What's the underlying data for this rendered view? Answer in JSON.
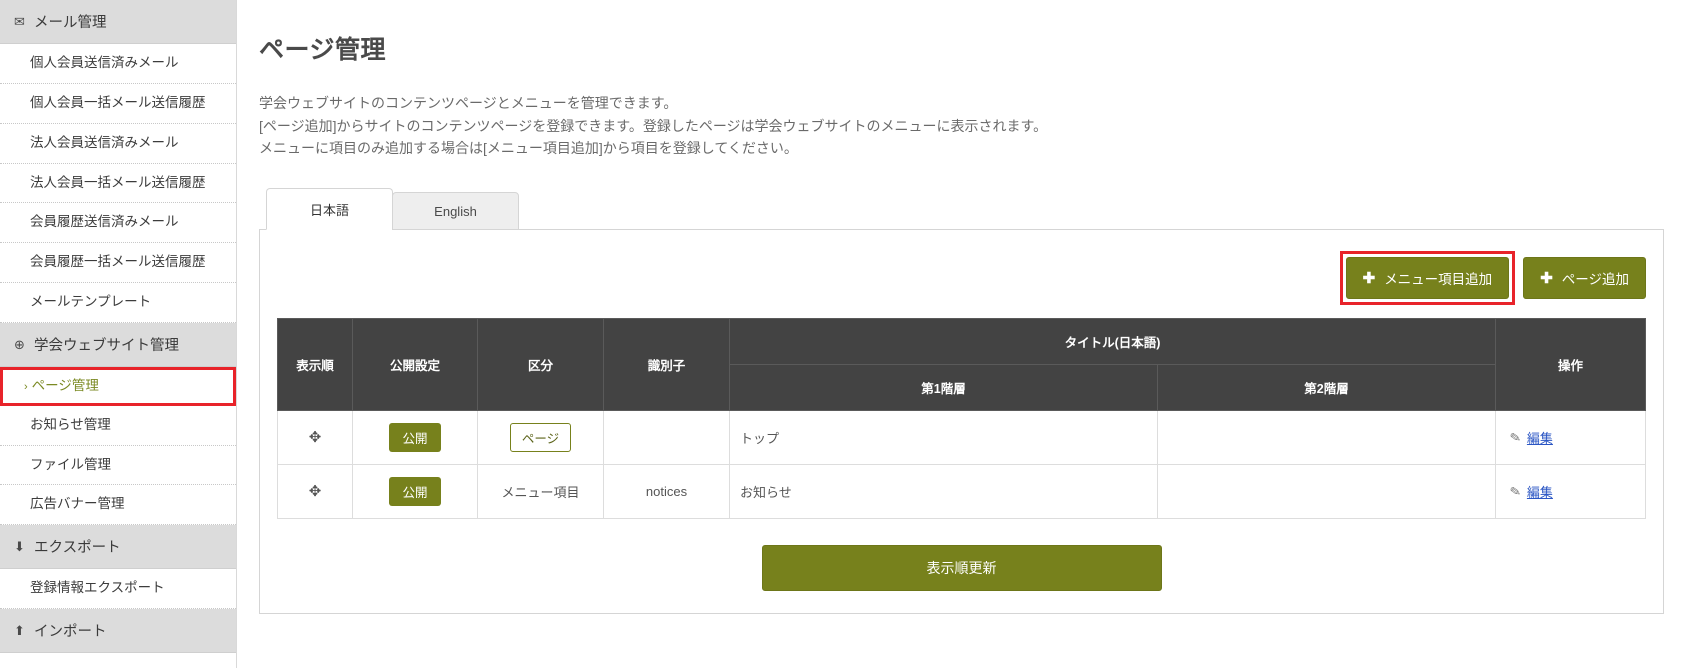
{
  "sidebar": {
    "sections": [
      {
        "label": "メール管理",
        "icon": "mail-icon",
        "glyph": "✉",
        "items": [
          {
            "label": "個人会員送信済みメール"
          },
          {
            "label": "個人会員一括メール送信履歴"
          },
          {
            "label": "法人会員送信済みメール"
          },
          {
            "label": "法人会員一括メール送信履歴"
          },
          {
            "label": "会員履歴送信済みメール"
          },
          {
            "label": "会員履歴一括メール送信履歴"
          },
          {
            "label": "メールテンプレート"
          }
        ]
      },
      {
        "label": "学会ウェブサイト管理",
        "icon": "globe-icon",
        "glyph": "⊕",
        "items": [
          {
            "label": "ページ管理",
            "selected": true,
            "caret": "›"
          },
          {
            "label": "お知らせ管理"
          },
          {
            "label": "ファイル管理"
          },
          {
            "label": "広告バナー管理"
          }
        ]
      },
      {
        "label": "エクスポート",
        "icon": "download-icon",
        "glyph": "⬇",
        "items": [
          {
            "label": "登録情報エクスポート"
          }
        ]
      },
      {
        "label": "インポート",
        "icon": "upload-icon",
        "glyph": "⬆",
        "items": []
      }
    ]
  },
  "main": {
    "title": "ページ管理",
    "description": [
      "学会ウェブサイトのコンテンツページとメニューを管理できます。",
      "[ページ追加]からサイトのコンテンツページを登録できます。登録したページは学会ウェブサイトのメニューに表示されます。",
      "メニューに項目のみ追加する場合は[メニュー項目追加]から項目を登録してください。"
    ],
    "tabs": [
      {
        "label": "日本語",
        "active": true
      },
      {
        "label": "English",
        "active": false
      }
    ],
    "buttons": {
      "add_menu_item": "メニュー項目追加",
      "add_page": "ページ追加",
      "plus_glyph": "✚",
      "update_order": "表示順更新"
    },
    "table": {
      "headers": {
        "order": "表示順",
        "publish": "公開設定",
        "kind": "区分",
        "identifier": "識別子",
        "title_group": "タイトル(日本語)",
        "level1": "第1階層",
        "level2": "第2階層",
        "action": "操作"
      },
      "rows": [
        {
          "drag": "✥",
          "publish": "公開",
          "kind": "ページ",
          "kind_style": "outlined",
          "identifier": "",
          "level1": "トップ",
          "level2": "",
          "action": "編集",
          "pencil": "✎"
        },
        {
          "drag": "✥",
          "publish": "公開",
          "kind": "メニュー項目",
          "kind_style": "plain",
          "identifier": "notices",
          "level1": "お知らせ",
          "level2": "",
          "action": "編集",
          "pencil": "✎"
        }
      ]
    }
  },
  "colors": {
    "accent_olive": "#77811c",
    "annotation_red": "#e8232a",
    "header_dark": "#434343",
    "link_blue": "#2b56c4",
    "selected_text": "#7b8a23"
  }
}
